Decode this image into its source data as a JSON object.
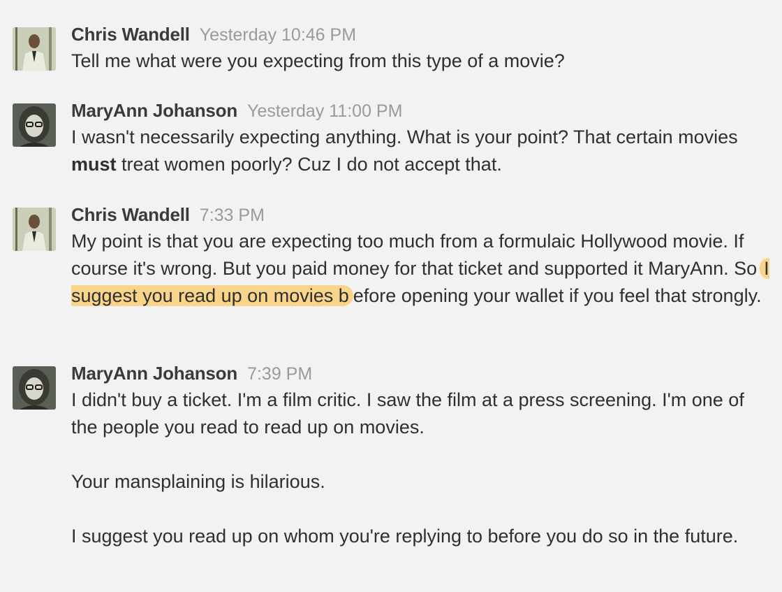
{
  "comments": [
    {
      "author": "Chris Wandell",
      "time": "Yesterday 10:46 PM",
      "text": "Tell me what were you expecting from this type of a movie?"
    },
    {
      "author": "MaryAnn Johanson",
      "time": "Yesterday 11:00 PM",
      "text_before": "I wasn't necessarily expecting anything. What is your point? That certain movies ",
      "text_bold": "must",
      "text_after": " treat women poorly? Cuz I do not accept that."
    },
    {
      "author": "Chris Wandell",
      "time": "7:33 PM",
      "text_before": "My point is that you are expecting too much from a formulaic Hollywood movie. If course it's wrong. But you paid money for that ticket and supported it MaryAnn. So",
      "text_highlight": "I suggest you read up on movies b",
      "text_after": "efore opening your wallet if you feel that strongly."
    },
    {
      "author": "MaryAnn Johanson",
      "time": "7:39 PM",
      "paragraphs": [
        "I didn't buy a ticket. I'm a film critic. I saw the film at a press screening. I'm one of the people you read to read up on movies.",
        "Your mansplaining is hilarious.",
        "I suggest you read up on whom you're replying to before you do so in the future."
      ]
    }
  ],
  "colors": {
    "background": "#f2f2f2",
    "author": "#3a3a3a",
    "timestamp": "#9a9a9a",
    "text": "#2f2f2f",
    "highlight": "#f9d48b"
  }
}
